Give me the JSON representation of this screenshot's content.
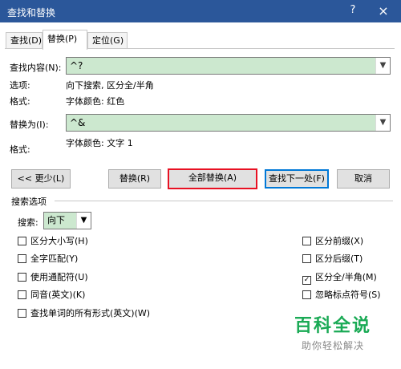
{
  "window": {
    "title": "查找和替换",
    "help": "?",
    "close": "×"
  },
  "tabs": [
    {
      "label": "查找(D)"
    },
    {
      "label": "替换(P)"
    },
    {
      "label": "定位(G)"
    }
  ],
  "find": {
    "label": "查找内容(N):",
    "value": "^?",
    "options_label": "选项:",
    "options_value": "向下搜索, 区分全/半角",
    "format_label": "格式:",
    "format_value": "字体颜色: 红色"
  },
  "replace": {
    "label": "替换为(I):",
    "value": "^&",
    "format_label": "格式:",
    "format_value": "字体颜色: 文字 1"
  },
  "buttons": {
    "less": "<< 更少(L)",
    "replace": "替换(R)",
    "replace_all": "全部替换(A)",
    "find_next": "查找下一处(F)",
    "cancel": "取消"
  },
  "search_options": {
    "title": "搜索选项",
    "search_label": "搜索:",
    "search_value": "向下",
    "left": [
      {
        "label": "区分大小写(H)",
        "checked": false
      },
      {
        "label": "全字匹配(Y)",
        "checked": false
      },
      {
        "label": "使用通配符(U)",
        "checked": false
      },
      {
        "label": "同音(英文)(K)",
        "checked": false
      },
      {
        "label": "查找单词的所有形式(英文)(W)",
        "checked": false
      }
    ],
    "right": [
      {
        "label": "区分前缀(X)",
        "checked": false
      },
      {
        "label": "区分后缀(T)",
        "checked": false
      },
      {
        "label": "区分全/半角(M)",
        "checked": true
      },
      {
        "label": "忽略标点符号(S)",
        "checked": false
      }
    ]
  },
  "watermark": {
    "title": "百科全说",
    "subtitle": "助你轻松解决"
  }
}
